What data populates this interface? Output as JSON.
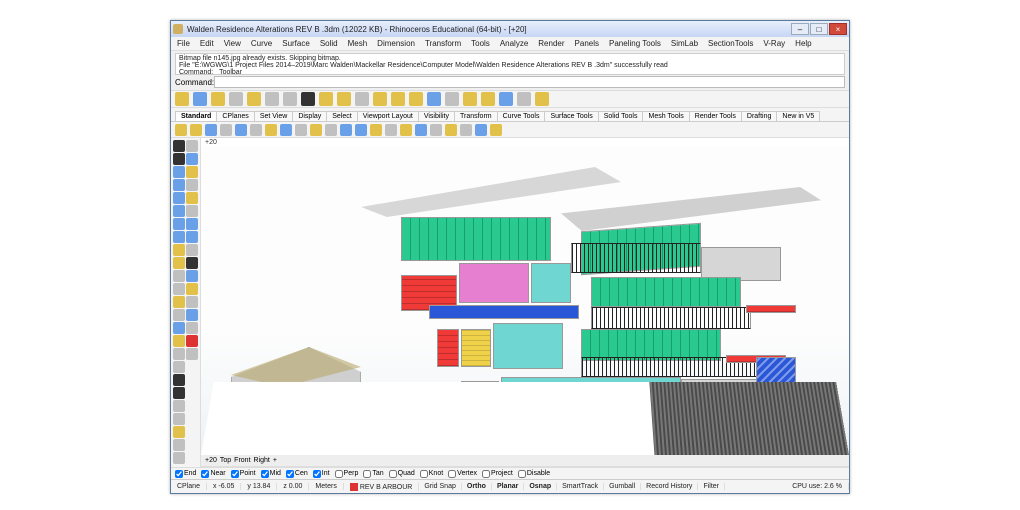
{
  "title": "Walden Residence Alterations REV B .3dm (12022 KB) - Rhinoceros Educational (64-bit) - [+20]",
  "menus": [
    "File",
    "Edit",
    "View",
    "Curve",
    "Surface",
    "Solid",
    "Mesh",
    "Dimension",
    "Transform",
    "Tools",
    "Analyze",
    "Render",
    "Panels",
    "Paneling Tools",
    "SimLab",
    "SectionTools",
    "V-Ray",
    "Help"
  ],
  "cmd_history": [
    "Bitmap file n145.jpg already exists. Skipping bitmap.",
    "File \"E:\\WGWG\\1 Project Files 2014–2019\\Marc Walden\\Mackellar Residence\\Computer Model\\Walden Residence Alterations REV B .3dm\" successfully read",
    "Command: _Toolbar"
  ],
  "cmd_label": "Command:",
  "cmd_value": "",
  "tabstrip": [
    "Standard",
    "CPlanes",
    "Set View",
    "Display",
    "Select",
    "Viewport Layout",
    "Visibility",
    "Transform",
    "Curve Tools",
    "Surface Tools",
    "Solid Tools",
    "Mesh Tools",
    "Render Tools",
    "Drafting",
    "New in V5"
  ],
  "active_tab": 0,
  "viewport_title": "+20",
  "vptabs_bottom": [
    "+20",
    "Top",
    "Front",
    "Right",
    "+"
  ],
  "osnap": {
    "items": [
      {
        "label": "End",
        "checked": true
      },
      {
        "label": "Near",
        "checked": true
      },
      {
        "label": "Point",
        "checked": true
      },
      {
        "label": "Mid",
        "checked": true
      },
      {
        "label": "Cen",
        "checked": true
      },
      {
        "label": "Int",
        "checked": true
      },
      {
        "label": "Perp",
        "checked": false
      },
      {
        "label": "Tan",
        "checked": false
      },
      {
        "label": "Quad",
        "checked": false
      },
      {
        "label": "Knot",
        "checked": false
      },
      {
        "label": "Vertex",
        "checked": false
      },
      {
        "label": "Project",
        "checked": false
      },
      {
        "label": "Disable",
        "checked": false
      }
    ]
  },
  "status": {
    "cplane": "CPlane",
    "x": "x -6.05",
    "y": "y 13.84",
    "z": "z 0.00",
    "units": "Meters",
    "layer_color": "#d33",
    "layer": "REV B ARBOUR",
    "toggles": [
      {
        "label": "Grid Snap",
        "on": false
      },
      {
        "label": "Ortho",
        "on": true
      },
      {
        "label": "Planar",
        "on": true
      },
      {
        "label": "Osnap",
        "on": true
      },
      {
        "label": "SmartTrack",
        "on": false
      },
      {
        "label": "Gumball",
        "on": false
      },
      {
        "label": "Record History",
        "on": false
      },
      {
        "label": "Filter",
        "on": false
      }
    ],
    "cpu": "CPU use: 2.6 %"
  },
  "colors": {
    "tb": [
      "#e2c14a",
      "#6aa0e8",
      "#e2c14a",
      "#c0c0c0",
      "#e2c14a",
      "#c0c0c0",
      "#c0c0c0",
      "#333",
      "#e2c14a",
      "#e2c14a",
      "#c0c0c0",
      "#e2c14a",
      "#e2c14a",
      "#e2c14a",
      "#6aa0e8",
      "#c0c0c0",
      "#e2c14a",
      "#e2c14a",
      "#6aa0e8",
      "#c0c0c0",
      "#e2c14a"
    ],
    "tb2": [
      "#e2c14a",
      "#e2c14a",
      "#6aa0e8",
      "#c0c0c0",
      "#6aa0e8",
      "#c0c0c0",
      "#e2c14a",
      "#6aa0e8",
      "#c0c0c0",
      "#e2c14a",
      "#c0c0c0",
      "#6aa0e8",
      "#6aa0e8",
      "#e2c14a",
      "#c0c0c0",
      "#e2c14a",
      "#6aa0e8",
      "#c0c0c0",
      "#e2c14a",
      "#c0c0c0",
      "#6aa0e8",
      "#e2c14a"
    ],
    "left": [
      "#333",
      "#333",
      "#6aa0e8",
      "#6aa0e8",
      "#6aa0e8",
      "#6aa0e8",
      "#6aa0e8",
      "#6aa0e8",
      "#e2c14a",
      "#e2c14a",
      "#c0c0c0",
      "#c0c0c0",
      "#e2c14a",
      "#c0c0c0",
      "#6aa0e8",
      "#e2c14a",
      "#c0c0c0",
      "#c0c0c0",
      "#333",
      "#333",
      "#c0c0c0",
      "#c0c0c0",
      "#e2c14a",
      "#c0c0c0",
      "#c0c0c0",
      "#c0c0c0",
      "#6aa0e8",
      "#e2c14a",
      "#c0c0c0",
      "#e2c14a",
      "#c0c0c0",
      "#6aa0e8",
      "#6aa0e8",
      "#c0c0c0",
      "#333",
      "#6aa0e8",
      "#e2c14a",
      "#c0c0c0",
      "#6aa0e8",
      "#c0c0c0",
      "#d33",
      "#c0c0c0"
    ]
  }
}
